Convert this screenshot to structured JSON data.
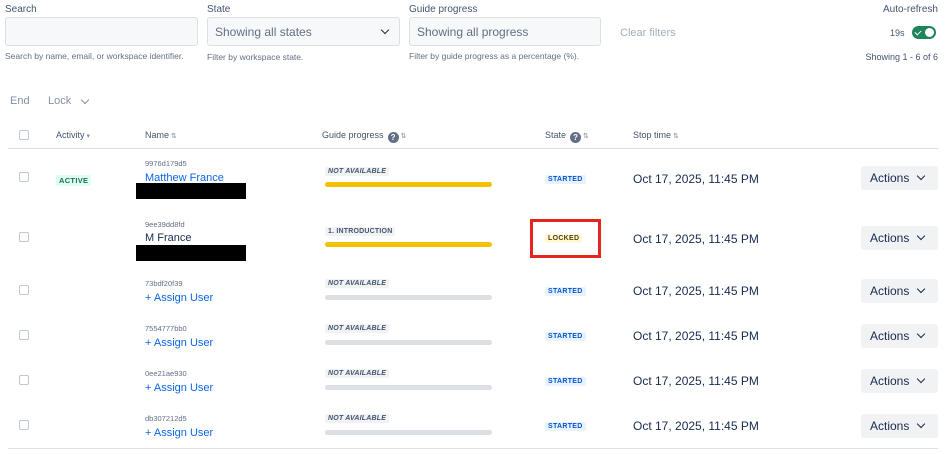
{
  "filters": {
    "search": {
      "label": "Search",
      "value": "",
      "help": "Search by name, email, or workspace identifier."
    },
    "state": {
      "label": "State",
      "value": "Showing all states",
      "help": "Filter by workspace state."
    },
    "guide_progress": {
      "label": "Guide progress",
      "value": "Showing all progress",
      "help": "Filter by guide progress as a percentage (%)."
    },
    "clear_label": "Clear filters"
  },
  "auto_refresh": {
    "label": "Auto-refresh",
    "countdown": "19s",
    "enabled": true
  },
  "showing": "Showing 1 - 6 of 6",
  "bulk_actions": {
    "end": "End",
    "lock": "Lock"
  },
  "columns": {
    "activity": "Activity",
    "name": "Name",
    "guide_progress": "Guide progress",
    "state": "State",
    "stop_time": "Stop time"
  },
  "rows": [
    {
      "activity": "ACTIVE",
      "identifier": "9976d179d5",
      "name": "Matthew France",
      "progress_label": "NOT AVAILABLE",
      "progress": 1.0,
      "state": "STARTED",
      "stop_time": "Oct 17, 2025, 11:45 PM",
      "actions": "Actions"
    },
    {
      "activity": "",
      "identifier": "9ee39dd8fd",
      "name": "M France",
      "progress_label": "1. INTRODUCTION",
      "progress": 1.0,
      "state": "LOCKED",
      "stop_time": "Oct 17, 2025, 11:45 PM",
      "actions": "Actions"
    },
    {
      "activity": "",
      "identifier": "73bdf20f39",
      "name": "+ Assign User",
      "progress_label": "NOT AVAILABLE",
      "progress": 0,
      "state": "STARTED",
      "stop_time": "Oct 17, 2025, 11:45 PM",
      "actions": "Actions"
    },
    {
      "activity": "",
      "identifier": "7554777bb0",
      "name": "+ Assign User",
      "progress_label": "NOT AVAILABLE",
      "progress": 0,
      "state": "STARTED",
      "stop_time": "Oct 17, 2025, 11:45 PM",
      "actions": "Actions"
    },
    {
      "activity": "",
      "identifier": "0ee21ae930",
      "name": "+ Assign User",
      "progress_label": "NOT AVAILABLE",
      "progress": 0,
      "state": "STARTED",
      "stop_time": "Oct 17, 2025, 11:45 PM",
      "actions": "Actions"
    },
    {
      "activity": "",
      "identifier": "db307212d5",
      "name": "+ Assign User",
      "progress_label": "NOT AVAILABLE",
      "progress": 0,
      "state": "STARTED",
      "stop_time": "Oct 17, 2025, 11:45 PM",
      "actions": "Actions"
    }
  ],
  "colors": {
    "accent": "#0c66e4",
    "progress": "#f5c000",
    "toggle_on": "#1f845a",
    "highlight": "#e2261d"
  }
}
